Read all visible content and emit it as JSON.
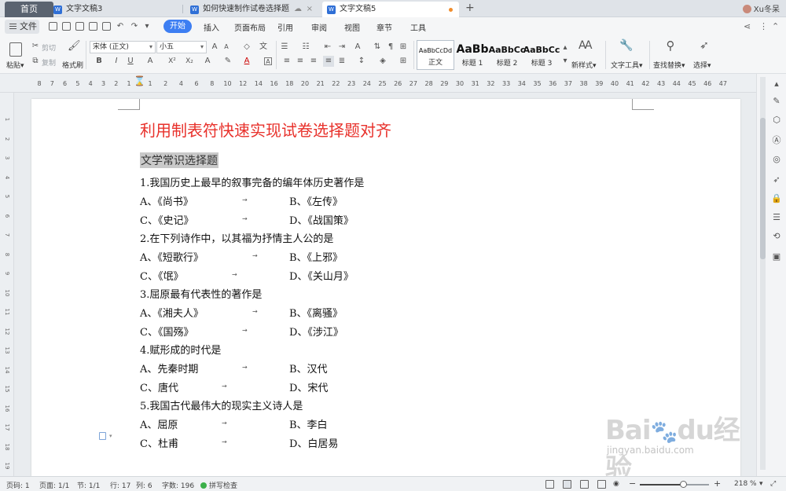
{
  "tabs": {
    "home": "首页",
    "items": [
      {
        "label": "文字文稿3",
        "icon": "W"
      },
      {
        "label": "如何快速制作试卷选择题",
        "icon": "cloud"
      },
      {
        "label": "文字文稿5",
        "icon": "W"
      }
    ],
    "close": "×",
    "new_tab": "+",
    "user": "Xu冬呆"
  },
  "menu": {
    "file": "文件",
    "items": [
      "开始",
      "插入",
      "页面布局",
      "引用",
      "审阅",
      "视图",
      "章节",
      "工具"
    ],
    "active": "开始"
  },
  "ribbon": {
    "paste": "粘贴",
    "cut": "剪切",
    "copy": "复制",
    "format_painter": "格式刷",
    "font_name": "宋体 (正文)",
    "font_size": "小五",
    "styles": [
      {
        "sample": "AaBbCcDd",
        "name": "正文"
      },
      {
        "sample": "AaBb",
        "name": "标题 1"
      },
      {
        "sample": "AaBbCc",
        "name": "标题 2"
      },
      {
        "sample": "AaBbCc",
        "name": "标题 3"
      }
    ],
    "new_style": "新样式",
    "text_tools": "文字工具",
    "find_replace": "查找替换",
    "select": "选择",
    "dropdown_arrow": "▾"
  },
  "ruler": {
    "left_ticks": [
      "8",
      "7",
      "6",
      "5",
      "4",
      "3",
      "2",
      "1"
    ],
    "right_ticks": [
      "1",
      "2",
      "4",
      "6",
      "8",
      "10",
      "12",
      "14",
      "16",
      "18",
      "20",
      "21",
      "22",
      "23",
      "24",
      "25",
      "26",
      "27",
      "28",
      "29",
      "30",
      "31",
      "32",
      "33",
      "34",
      "35",
      "36",
      "37",
      "38",
      "39",
      "40",
      "41",
      "42",
      "43",
      "44",
      "45",
      "46",
      "47"
    ],
    "vertical_ticks": [
      "1",
      "2",
      "3",
      "4",
      "5",
      "6",
      "7",
      "8",
      "9",
      "10",
      "11",
      "12",
      "13",
      "14",
      "15",
      "16",
      "17",
      "18",
      "19"
    ]
  },
  "document": {
    "title": "利用制表符快速实现试卷选择题对齐",
    "heading": "文学常识选择题",
    "tab_mark": "→",
    "questions": [
      {
        "q": "1.我国历史上最早的叙事完备的编年体历史著作是",
        "a": "A、《尚书》",
        "b": "B、《左传》",
        "c": "C、《史记》",
        "d": "D、《战国策》"
      },
      {
        "q": "2.在下列诗作中，以其福为抒情主人公的是",
        "a": "A、《短歌行》",
        "b": "B、《上邪》",
        "c": "C、《氓》",
        "d": "D、《关山月》"
      },
      {
        "q": "3.屈原最有代表性的著作是",
        "a": "A、《湘夫人》",
        "b": "B、《离骚》",
        "c": "C、《国殇》",
        "d": "D、《涉江》"
      },
      {
        "q": "4.赋形成的时代是",
        "a": "A、先秦时期",
        "b": "B、汉代",
        "c": "C、唐代",
        "d": "D、宋代"
      },
      {
        "q": "5.我国古代最伟大的现实主义诗人是",
        "a": "A、屈原",
        "b": "B、李白",
        "c": "C、杜甫",
        "d": "D、白居易"
      }
    ]
  },
  "watermark": {
    "brand": "Baidu经验",
    "url": "jingyan.baidu.com"
  },
  "status": {
    "page_num": "页码: 1",
    "pages": "页面: 1/1",
    "section": "节: 1/1",
    "row": "行: 17",
    "col": "列: 6",
    "chars": "字数: 196",
    "spell": "拼写检查",
    "zoom": "218 %",
    "zoom_fraction": 0.62,
    "minus": "−",
    "plus": "+"
  }
}
